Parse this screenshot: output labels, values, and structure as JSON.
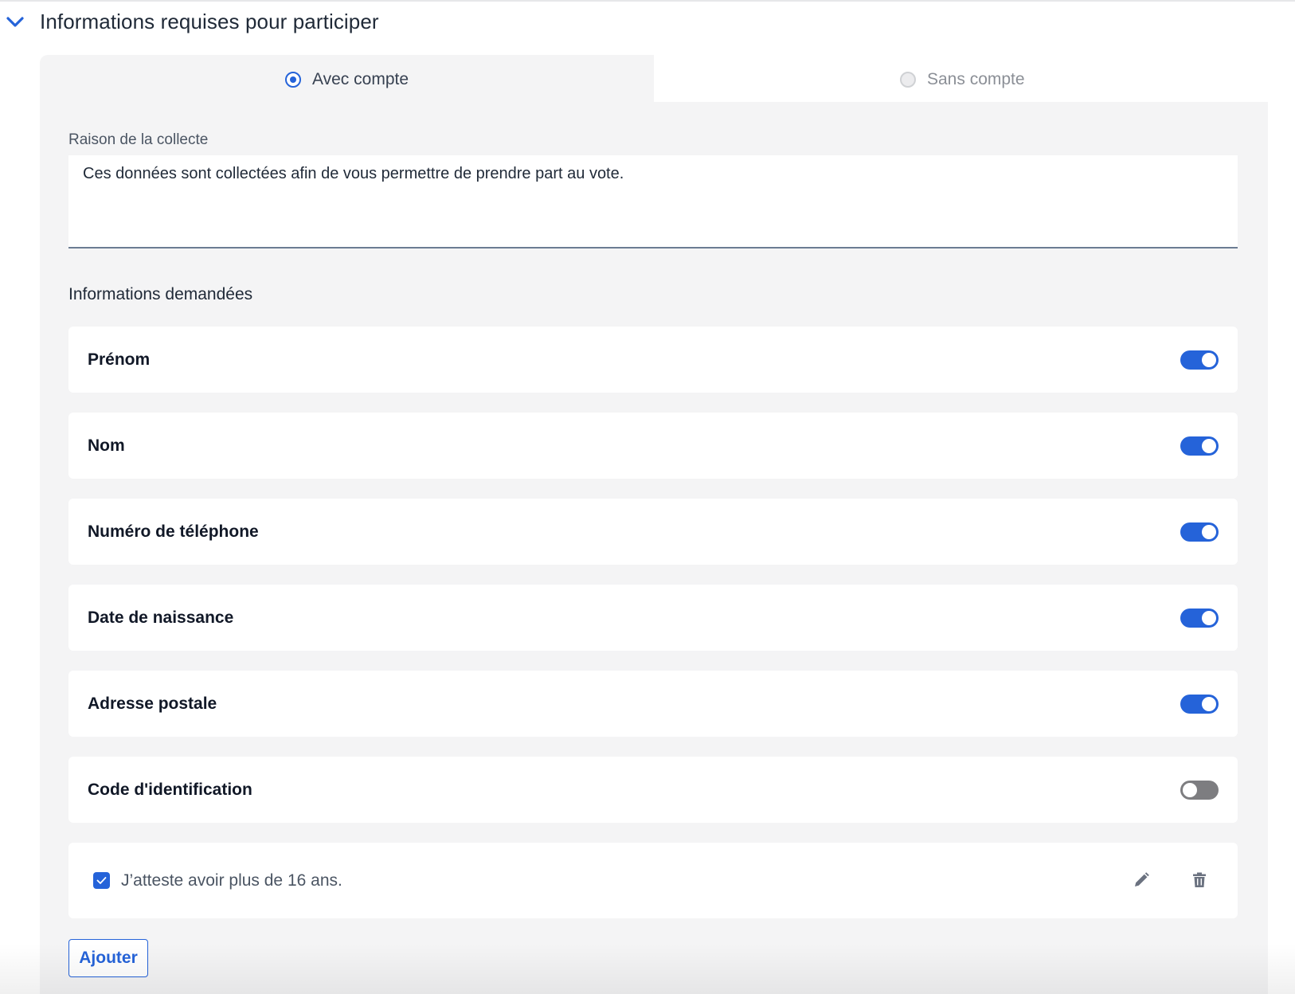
{
  "section": {
    "title": "Informations requises pour participer",
    "expand_icon": "chevron-down-icon"
  },
  "tabs": [
    {
      "label": "Avec compte",
      "selected": true
    },
    {
      "label": "Sans compte",
      "selected": false
    }
  ],
  "collection_reason": {
    "label": "Raison de la collecte",
    "value": "Ces données sont collectées afin de vous permettre de prendre part au vote."
  },
  "requested_info": {
    "heading": "Informations demandées",
    "items": [
      {
        "label": "Prénom",
        "enabled": true
      },
      {
        "label": "Nom",
        "enabled": true
      },
      {
        "label": "Numéro de téléphone",
        "enabled": true
      },
      {
        "label": "Date de naissance",
        "enabled": true
      },
      {
        "label": "Adresse postale",
        "enabled": true
      },
      {
        "label": "Code d'identification",
        "enabled": false
      }
    ]
  },
  "custom_field": {
    "checked": true,
    "text": "J’atteste avoir plus de 16 ans.",
    "edit_icon": "pencil-icon",
    "delete_icon": "trash-icon"
  },
  "add_button": {
    "label": "Ajouter"
  },
  "colors": {
    "accent": "#2563d9",
    "panel_bg": "#f4f4f5",
    "toggle_off": "#7d7d80"
  }
}
